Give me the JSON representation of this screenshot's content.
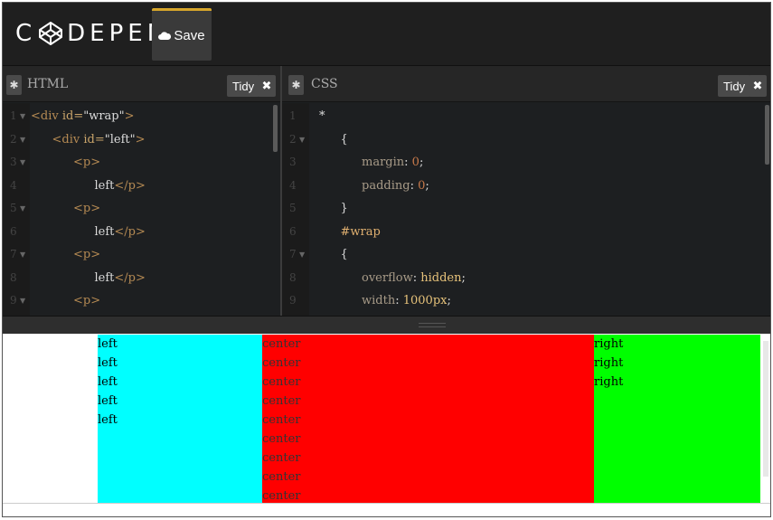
{
  "app": {
    "logo_text": "DEPEN",
    "logo_prefix": "C"
  },
  "toolbar": {
    "save_label": "Save"
  },
  "html_pane": {
    "title": "HTML",
    "tidy_label": "Tidy",
    "lines": [
      {
        "n": "1",
        "fold": "▼",
        "parts": [
          {
            "c": "tag",
            "t": "<div "
          },
          {
            "c": "attr",
            "t": "id="
          },
          {
            "c": "plain",
            "t": "\"wrap\""
          },
          {
            "c": "tag",
            "t": ">"
          }
        ],
        "indent": 0
      },
      {
        "n": "2",
        "fold": "▼",
        "parts": [
          {
            "c": "tag",
            "t": "<div "
          },
          {
            "c": "attr",
            "t": "id="
          },
          {
            "c": "plain",
            "t": "\"left\""
          },
          {
            "c": "tag",
            "t": ">"
          }
        ],
        "indent": 1
      },
      {
        "n": "3",
        "fold": "▼",
        "parts": [
          {
            "c": "tag",
            "t": "<p>"
          }
        ],
        "indent": 2
      },
      {
        "n": "4",
        "fold": "",
        "parts": [
          {
            "c": "plain",
            "t": "left"
          },
          {
            "c": "tag",
            "t": "</p>"
          }
        ],
        "indent": 3
      },
      {
        "n": "5",
        "fold": "▼",
        "parts": [
          {
            "c": "tag",
            "t": "<p>"
          }
        ],
        "indent": 2
      },
      {
        "n": "6",
        "fold": "",
        "parts": [
          {
            "c": "plain",
            "t": "left"
          },
          {
            "c": "tag",
            "t": "</p>"
          }
        ],
        "indent": 3
      },
      {
        "n": "7",
        "fold": "▼",
        "parts": [
          {
            "c": "tag",
            "t": "<p>"
          }
        ],
        "indent": 2
      },
      {
        "n": "8",
        "fold": "",
        "parts": [
          {
            "c": "plain",
            "t": "left"
          },
          {
            "c": "tag",
            "t": "</p>"
          }
        ],
        "indent": 3
      },
      {
        "n": "9",
        "fold": "▼",
        "parts": [
          {
            "c": "tag",
            "t": "<p>"
          }
        ],
        "indent": 2
      }
    ]
  },
  "css_pane": {
    "title": "CSS",
    "tidy_label": "Tidy",
    "lines": [
      {
        "n": "1",
        "fold": "",
        "parts": [
          {
            "c": "plain",
            "t": "*"
          }
        ],
        "indent": 0
      },
      {
        "n": "2",
        "fold": "▼",
        "parts": [
          {
            "c": "plain",
            "t": "{"
          }
        ],
        "indent": 1
      },
      {
        "n": "3",
        "fold": "",
        "parts": [
          {
            "c": "prop",
            "t": "margin"
          },
          {
            "c": "plain",
            "t": ": "
          },
          {
            "c": "num",
            "t": "0"
          },
          {
            "c": "plain",
            "t": ";"
          }
        ],
        "indent": 2
      },
      {
        "n": "4",
        "fold": "",
        "parts": [
          {
            "c": "prop",
            "t": "padding"
          },
          {
            "c": "plain",
            "t": ": "
          },
          {
            "c": "num",
            "t": "0"
          },
          {
            "c": "plain",
            "t": ";"
          }
        ],
        "indent": 2
      },
      {
        "n": "5",
        "fold": "",
        "parts": [
          {
            "c": "plain",
            "t": "}"
          }
        ],
        "indent": 1
      },
      {
        "n": "6",
        "fold": "",
        "parts": [
          {
            "c": "sel",
            "t": "#wrap"
          }
        ],
        "indent": 1
      },
      {
        "n": "7",
        "fold": "▼",
        "parts": [
          {
            "c": "plain",
            "t": "{"
          }
        ],
        "indent": 1
      },
      {
        "n": "8",
        "fold": "",
        "parts": [
          {
            "c": "prop",
            "t": "overflow"
          },
          {
            "c": "plain",
            "t": ": "
          },
          {
            "c": "val",
            "t": "hidden"
          },
          {
            "c": "plain",
            "t": ";"
          }
        ],
        "indent": 2
      },
      {
        "n": "9",
        "fold": "",
        "parts": [
          {
            "c": "prop",
            "t": "width"
          },
          {
            "c": "plain",
            "t": ": "
          },
          {
            "c": "val",
            "t": "1000px"
          },
          {
            "c": "plain",
            "t": ";"
          }
        ],
        "indent": 2
      }
    ]
  },
  "preview": {
    "left": [
      "left",
      "left",
      "left",
      "left",
      "left"
    ],
    "center": [
      "center",
      "center",
      "center",
      "center",
      "center",
      "center",
      "center",
      "center",
      "center"
    ],
    "right": [
      "right",
      "right",
      "right"
    ],
    "colors": {
      "left": "#00ffff",
      "center": "#ff0000",
      "right": "#00ff00"
    }
  }
}
